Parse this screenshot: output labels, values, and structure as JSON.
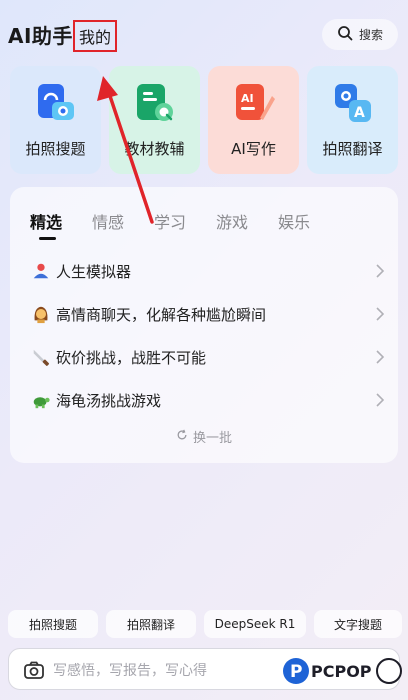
{
  "header": {
    "title": "AI助手",
    "my_tab": "我的",
    "search_label": "搜索"
  },
  "tools": [
    {
      "label": "拍照搜题",
      "icon": "photo-search-icon",
      "bg": "#dbe8fb"
    },
    {
      "label": "教材教辅",
      "icon": "textbook-icon",
      "bg": "#d7f3e7"
    },
    {
      "label": "AI写作",
      "icon": "ai-writing-icon",
      "bg": "#fcdcd7"
    },
    {
      "label": "拍照翻译",
      "icon": "photo-translate-icon",
      "bg": "#d9ecfb"
    }
  ],
  "tabs": [
    "精选",
    "情感",
    "学习",
    "游戏",
    "娱乐"
  ],
  "list": [
    {
      "text": "人生模拟器",
      "icon": "person-icon"
    },
    {
      "text": "高情商聊天，化解各种尴尬瞬间",
      "icon": "woman-icon"
    },
    {
      "text": "砍价挑战，战胜不可能",
      "icon": "knife-icon"
    },
    {
      "text": "海龟汤挑战游戏",
      "icon": "turtle-icon"
    }
  ],
  "refresh_label": "换一批",
  "chips": [
    "拍照搜题",
    "拍照翻译",
    "DeepSeek R1",
    "文字搜题"
  ],
  "input": {
    "placeholder": "写感悟，写报告，写心得"
  },
  "colors": {
    "highlight": "#e0242a",
    "accent_blue": "#2f6bef",
    "accent_green": "#1aa568",
    "accent_orange": "#f0523a"
  }
}
